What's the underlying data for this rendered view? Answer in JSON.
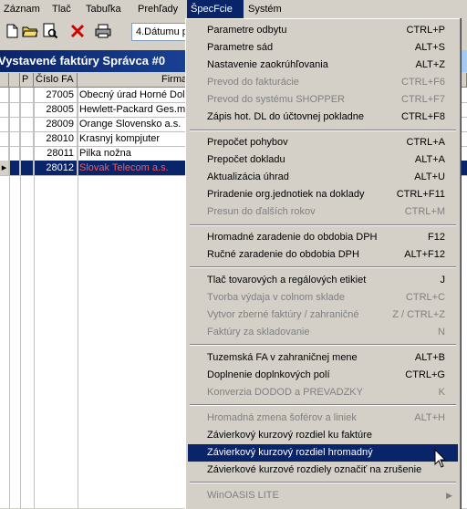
{
  "menubar": {
    "items": [
      "Záznam",
      "Tlač",
      "Tabuľka",
      "Prehľady",
      "ŠpecFcie",
      "Systém"
    ],
    "active_index": 4
  },
  "toolbar": {
    "combo_value": "4.Dátumu p"
  },
  "window": {
    "title": "Vystavené faktúry  Správca #0"
  },
  "grid": {
    "columns": [
      "P",
      "Číslo FA",
      "Firma"
    ],
    "rows": [
      {
        "number": "27005",
        "firma": "Obecný úrad Horné Dol"
      },
      {
        "number": "28005",
        "firma": "Hewlett-Packard Ges.m"
      },
      {
        "number": "28009",
        "firma": "Orange Slovensko a.s."
      },
      {
        "number": "28010",
        "firma": "Krasnyj kompjuter"
      },
      {
        "number": "28011",
        "firma": "Pilka nožna"
      },
      {
        "number": "28012",
        "firma": "Slovak Telecom a.s."
      }
    ],
    "selected_index": 5
  },
  "menu": {
    "items": [
      {
        "label": "Parametre odbytu",
        "shortcut": "CTRL+P",
        "enabled": true
      },
      {
        "label": "Parametre  sád",
        "shortcut": "ALT+S",
        "enabled": true
      },
      {
        "label": "Nastavenie zaokrúhľovania",
        "shortcut": "ALT+Z",
        "enabled": true
      },
      {
        "label": "Prevod do fakturácie",
        "shortcut": "CTRL+F6",
        "enabled": false
      },
      {
        "label": "Prevod do systému SHOPPER",
        "shortcut": "CTRL+F7",
        "enabled": false
      },
      {
        "label": "Zápis hot. DL do účtovnej pokladne",
        "shortcut": "CTRL+F8",
        "enabled": true
      },
      {
        "label": "Prepočet pohybov",
        "shortcut": "CTRL+A",
        "enabled": true
      },
      {
        "label": "Prepočet dokladu",
        "shortcut": "ALT+A",
        "enabled": true
      },
      {
        "label": "Aktualizácia úhrad",
        "shortcut": "ALT+U",
        "enabled": true
      },
      {
        "label": "Priradenie org.jednotiek na doklady",
        "shortcut": "CTRL+F11",
        "enabled": true
      },
      {
        "label": "Presun do ďalších rokov",
        "shortcut": "CTRL+M",
        "enabled": false
      },
      {
        "label": "Hromadné zaradenie do obdobia DPH",
        "shortcut": "F12",
        "enabled": true
      },
      {
        "label": "Ručné zaradenie do obdobia DPH",
        "shortcut": "ALT+F12",
        "enabled": true
      },
      {
        "label": "Tlač tovarových a regálových etikiet",
        "shortcut": "J",
        "enabled": true
      },
      {
        "label": "Tvorba výdaja v colnom sklade",
        "shortcut": "CTRL+C",
        "enabled": false
      },
      {
        "label": "Vytvor zberné faktúry / zahraničné",
        "shortcut": "Z / CTRL+Z",
        "enabled": false
      },
      {
        "label": "Faktúry za skladovanie",
        "shortcut": "N",
        "enabled": false
      },
      {
        "label": "Tuzemská FA v zahraničnej mene",
        "shortcut": "ALT+B",
        "enabled": true
      },
      {
        "label": "Doplnenie doplnkových polí",
        "shortcut": "CTRL+G",
        "enabled": true
      },
      {
        "label": "Konverzia DODOD a PREVADZKY",
        "shortcut": "K",
        "enabled": false
      },
      {
        "label": "Hromadná zmena šoférov a liniek",
        "shortcut": "ALT+H",
        "enabled": false
      },
      {
        "label": "Závierkový kurzový rozdiel ku faktúre",
        "shortcut": "",
        "enabled": true
      },
      {
        "label": "Závierkový kurzový rozdiel hromadný",
        "shortcut": "",
        "enabled": true,
        "highlighted": true
      },
      {
        "label": "Závierkové kurzové rozdiely označiť na zrušenie",
        "shortcut": "",
        "enabled": true
      },
      {
        "label": "WinOASIS LITE",
        "shortcut": "",
        "enabled": false,
        "submenu": true
      }
    ]
  },
  "colors": {
    "menu_bg": "#d4d0c8",
    "highlight": "#0a246a",
    "disabled_text": "#808080",
    "selected_firma": "#ff5555"
  }
}
